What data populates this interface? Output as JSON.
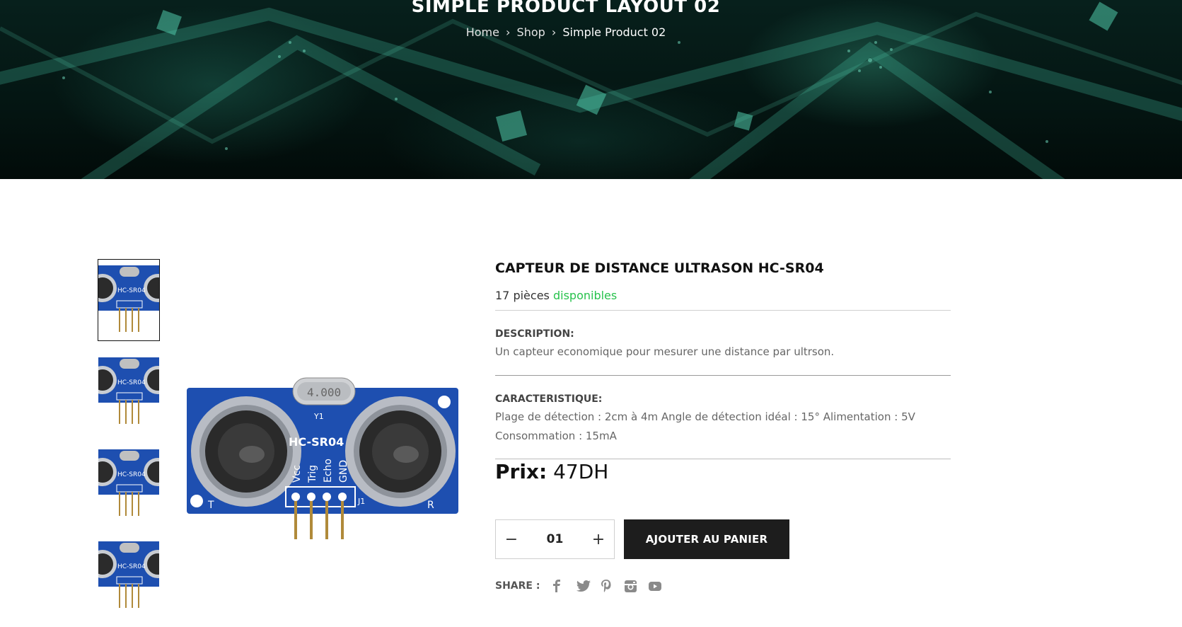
{
  "hero": {
    "title": "SIMPLE PRODUCT LAYOUT 02",
    "breadcrumb": {
      "items": [
        "Home",
        "Shop",
        "Simple Product 02"
      ],
      "separator": "›"
    }
  },
  "gallery": {
    "thumbnail_count": 4,
    "active_index": 0,
    "board_label": "HC-SR04",
    "crystal_label": "4.000",
    "pin_labels": [
      "Vcc",
      "Trig",
      "Echo",
      "GND"
    ],
    "marks": [
      "Y1",
      "J1",
      "T",
      "R"
    ],
    "board_color": "#1e4fb0"
  },
  "product": {
    "title": "CAPTEUR DE DISTANCE ULTRASON HC-SR04",
    "stock_count_text": "17 pièces",
    "stock_status": "disponibles",
    "stock_color": "#27c24c",
    "description_label": "DESCRIPTION:",
    "description": "Un capteur economique pour mesurer une distance par ultrson.",
    "characteristics_label": "CARACTERISTIQUE:",
    "characteristics": "Plage de détection : 2cm à 4m Angle de détection idéal : 15° Alimentation : 5V Consommation : 15mA",
    "price_label": "Prix:",
    "price_value": "47DH"
  },
  "cart": {
    "decrement_symbol": "−",
    "increment_symbol": "+",
    "quantity": "01",
    "add_to_cart_label": "AJOUTER AU PANIER",
    "button_color": "#1d1d1d"
  },
  "share": {
    "label": "SHARE :",
    "icons": [
      "facebook-icon",
      "twitter-icon",
      "pinterest-icon",
      "instagram-icon",
      "youtube-icon"
    ]
  }
}
